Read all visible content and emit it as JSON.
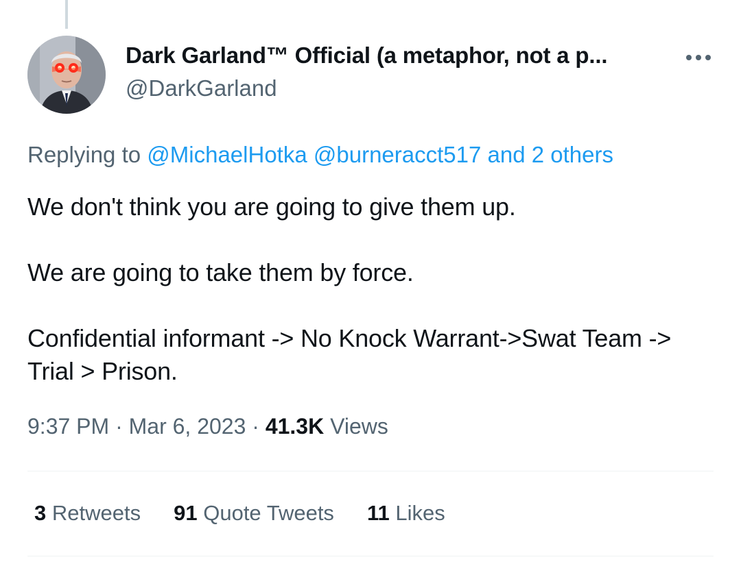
{
  "tweet": {
    "author": {
      "display_name": "Dark Garland™ Official (a metaphor, not a p...",
      "handle": "@DarkGarland",
      "avatar_icon": "profile-photo-glowing-red-eyes"
    },
    "more_icon": "more-horizontal-icon",
    "reply_context": {
      "prefix": "Replying to",
      "mention_1": "@MichaelHotka",
      "mention_2": "@burneracct517",
      "others": "and 2 others"
    },
    "text": {
      "line_1": "We don't think you are going to give them up.",
      "line_2": "We are going to take them by force.",
      "line_3": "Confidential informant -> No Knock Warrant->Swat Team -> Trial > Prison."
    },
    "meta": {
      "time": "9:37 PM",
      "separator": "·",
      "date": "Mar 6, 2023",
      "views_count": "41.3K",
      "views_label": "Views"
    },
    "stats": {
      "retweets_count": "3",
      "retweets_label": "Retweets",
      "quotes_count": "91",
      "quotes_label": "Quote Tweets",
      "likes_count": "11",
      "likes_label": "Likes"
    }
  },
  "colors": {
    "primary_text": "#0f1419",
    "secondary_text": "#536471",
    "link": "#1d9bf0",
    "divider": "#eff3f4",
    "thread_line": "#cfd9de"
  }
}
